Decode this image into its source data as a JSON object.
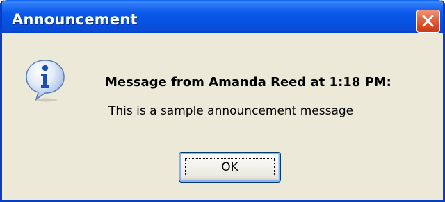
{
  "dialog": {
    "title": "Announcement",
    "icon": "info-icon",
    "heading": "Message from Amanda Reed at 1:18 PM:",
    "message": "This is a sample announcement message",
    "ok_label": "OK",
    "close_icon": "close-icon"
  },
  "colors": {
    "titlebar": "#0a59e8",
    "window_border": "#0a3cc4",
    "dialog_background": "#ece9d8",
    "close_button": "#e0562f"
  }
}
